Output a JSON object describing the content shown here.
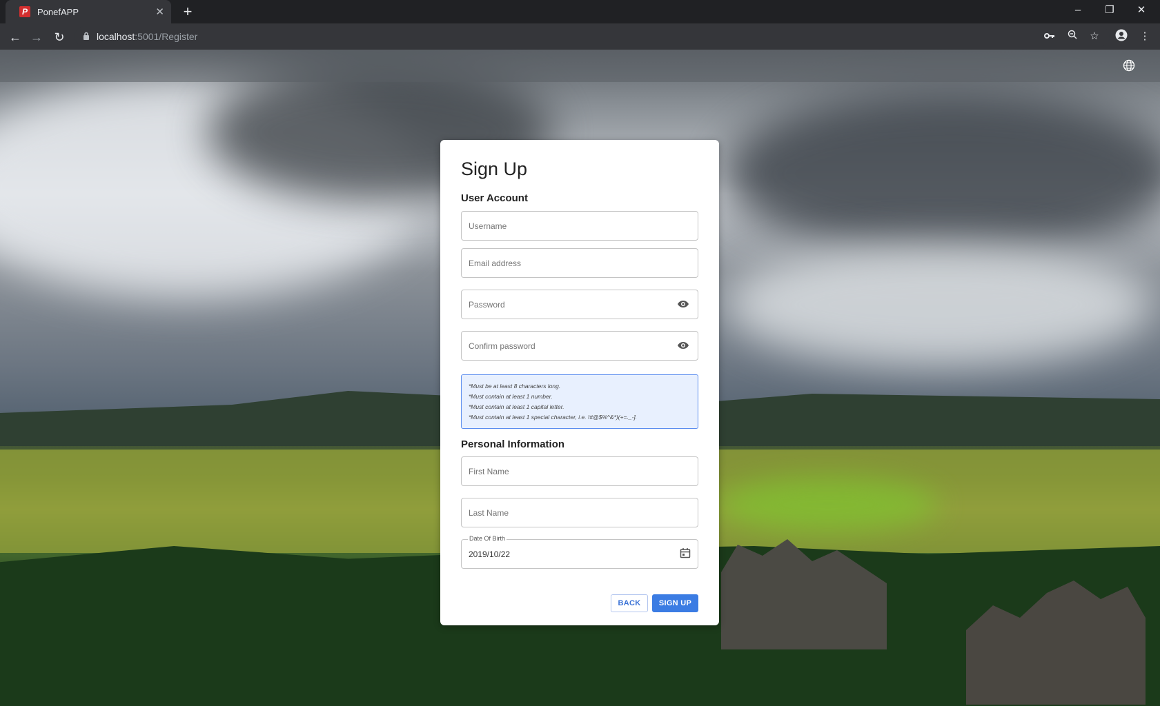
{
  "browser": {
    "tab_title": "PonefAPP",
    "favicon_letter": "P",
    "url_host": "localhost",
    "url_path": ":5001/Register"
  },
  "page": {
    "title": "Sign Up",
    "sections": {
      "account": "User Account",
      "personal": "Personal Information"
    },
    "fields": {
      "username": "Username",
      "email": "Email address",
      "password": "Password",
      "confirm_password": "Confirm password",
      "first_name": "First Name",
      "last_name": "Last Name",
      "dob_label": "Date Of Birth",
      "dob_value": "2019/10/22"
    },
    "password_rules": [
      "*Must be at least 8 characters long.",
      "*Must contain at least 1 number.",
      "*Must contain at least 1 capital letter.",
      "*Must contain at least 1 special character, i.e. !#@$%^&*)(+=._-]."
    ],
    "buttons": {
      "back": "BACK",
      "signup": "SIGN UP"
    }
  },
  "colors": {
    "primary": "#3b7ce3",
    "hint_bg": "#e8f0fe",
    "hint_border": "#5b8def"
  },
  "icons": [
    "globe-icon",
    "eye-icon",
    "calendar-icon",
    "lock-icon",
    "key-icon",
    "zoom-icon",
    "star-icon",
    "account-icon",
    "menu-icon"
  ]
}
